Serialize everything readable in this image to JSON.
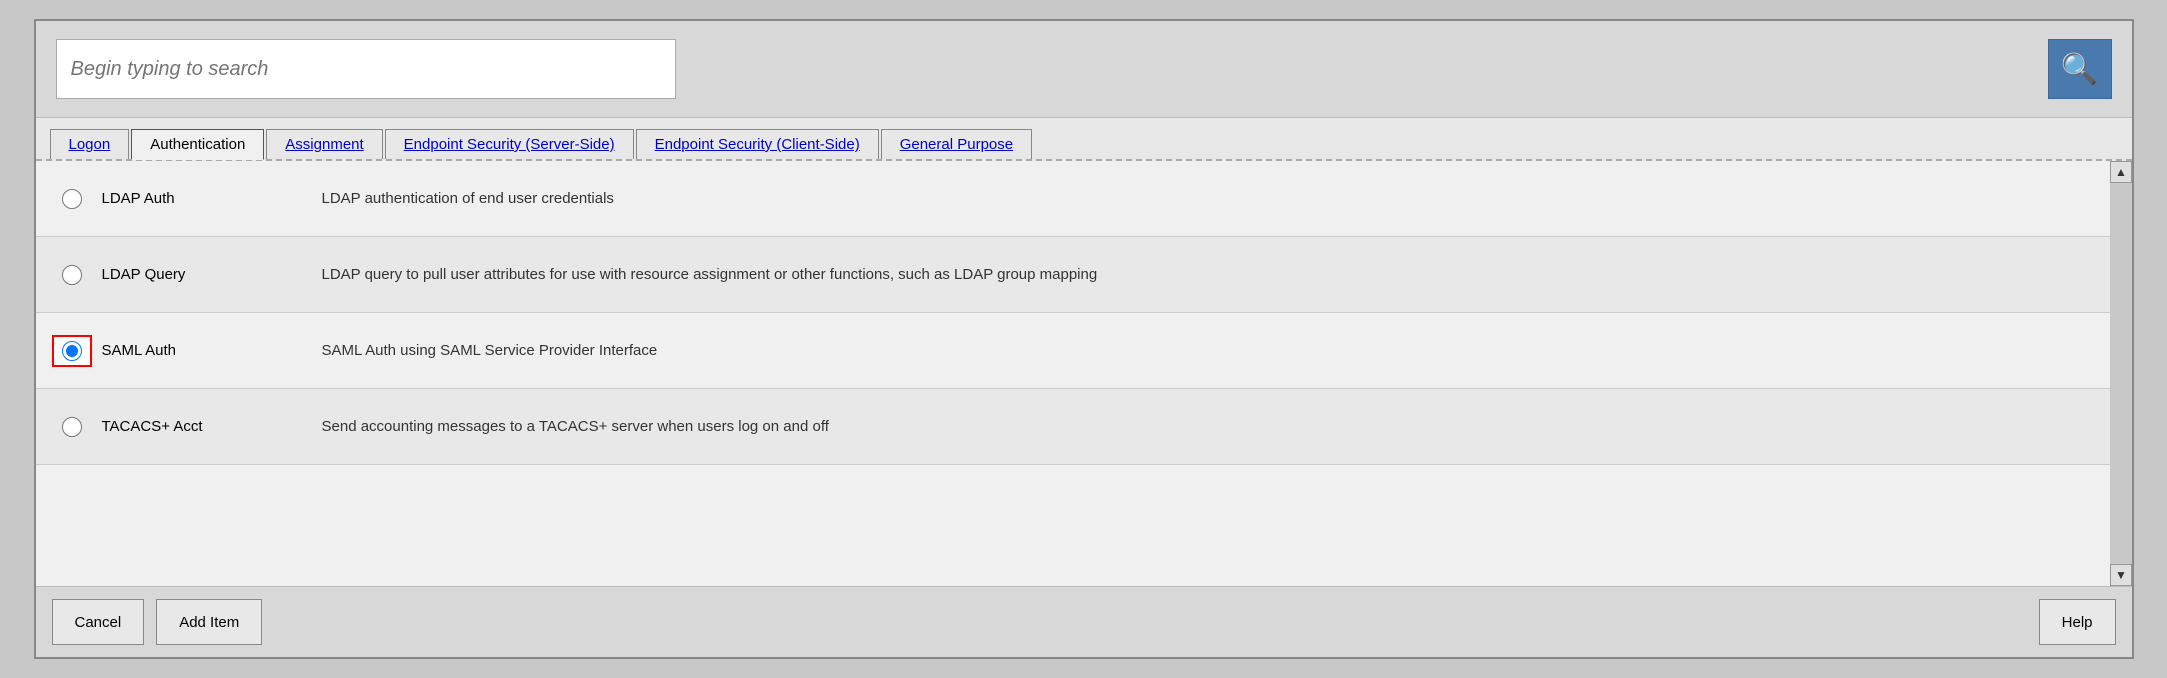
{
  "search": {
    "placeholder": "Begin typing to search"
  },
  "tabs": [
    {
      "id": "logon",
      "label": "Logon",
      "active": false
    },
    {
      "id": "authentication",
      "label": "Authentication",
      "active": true
    },
    {
      "id": "assignment",
      "label": "Assignment",
      "active": false
    },
    {
      "id": "endpoint-server",
      "label": "Endpoint Security (Server-Side)",
      "active": false
    },
    {
      "id": "endpoint-client",
      "label": "Endpoint Security (Client-Side)",
      "active": false
    },
    {
      "id": "general-purpose",
      "label": "General Purpose",
      "active": false
    }
  ],
  "items": [
    {
      "id": "ldap-auth",
      "name": "LDAP Auth",
      "description": "LDAP authentication of end user credentials",
      "selected": false
    },
    {
      "id": "ldap-query",
      "name": "LDAP Query",
      "description": "LDAP query to pull user attributes for use with resource assignment or other functions, such as LDAP group mapping",
      "selected": false
    },
    {
      "id": "saml-auth",
      "name": "SAML Auth",
      "description": "SAML Auth using SAML Service Provider Interface",
      "selected": true
    },
    {
      "id": "tacacs-acct",
      "name": "TACACS+ Acct",
      "description": "Send accounting messages to a TACACS+ server when users log on and off",
      "selected": false
    }
  ],
  "footer": {
    "cancel_label": "Cancel",
    "add_item_label": "Add Item",
    "help_label": "Help"
  },
  "icons": {
    "search": "🔍",
    "arrow_up": "▲",
    "arrow_down": "▼"
  }
}
